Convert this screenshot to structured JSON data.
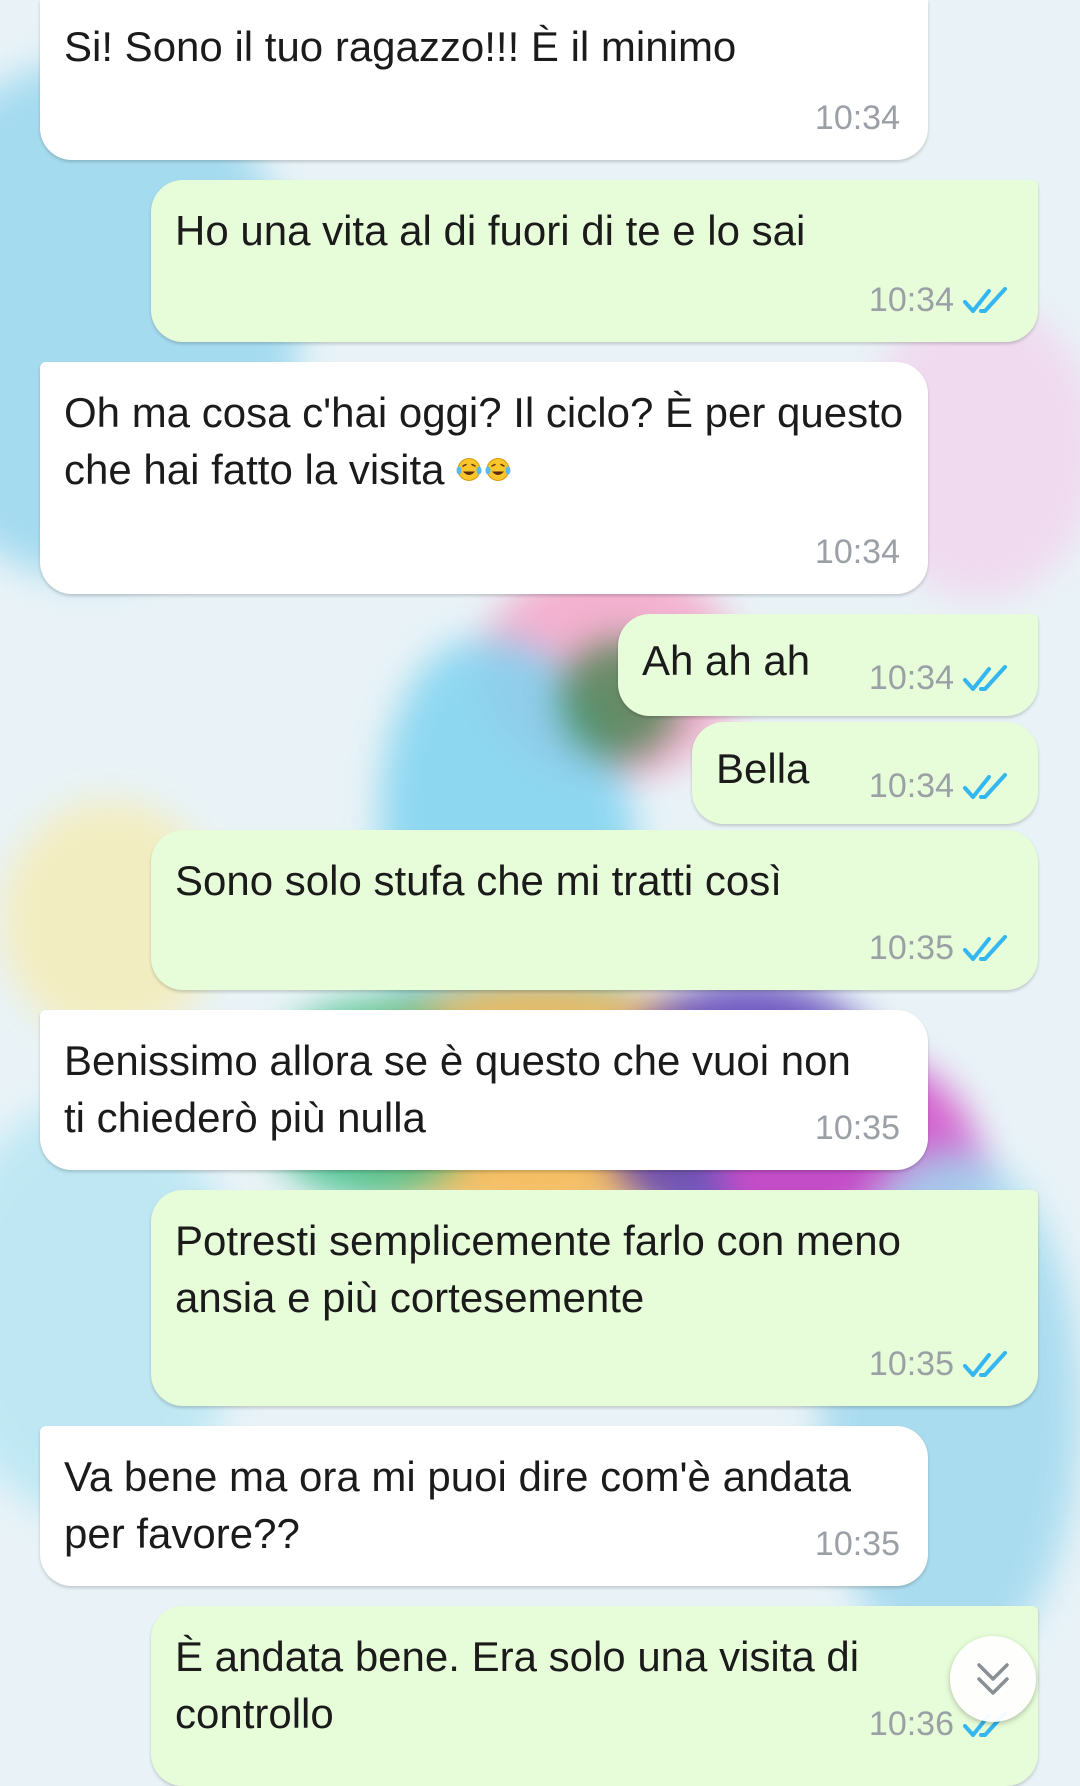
{
  "messages": [
    {
      "direction": "incoming",
      "text": "Si! Sono il tuo ragazzo!!! È il minimo",
      "time": "10:34"
    },
    {
      "direction": "outgoing",
      "text": "Ho una vita al di fuori di te e lo sai",
      "time": "10:34",
      "status": "read"
    },
    {
      "direction": "incoming",
      "text": "Oh ma cosa c'hai oggi? Il ciclo? È per questo che hai fatto la visita",
      "emoji": "tears-of-joy ×2",
      "time": "10:34"
    },
    {
      "direction": "outgoing",
      "text": "Ah ah ah",
      "time": "10:34",
      "status": "read"
    },
    {
      "direction": "outgoing",
      "text": "Bella",
      "time": "10:34",
      "status": "read"
    },
    {
      "direction": "outgoing",
      "text": "Sono solo stufa che mi tratti così",
      "time": "10:35",
      "status": "read"
    },
    {
      "direction": "incoming",
      "text": "Benissimo allora se è questo che vuoi non ti chiederò più nulla",
      "time": "10:35"
    },
    {
      "direction": "outgoing",
      "text": "Potresti semplicemente farlo con meno ansia e più cortesemente",
      "time": "10:35",
      "status": "read"
    },
    {
      "direction": "incoming",
      "text": "Va bene ma ora mi puoi dire com'è andata per favore??",
      "time": "10:35"
    },
    {
      "direction": "outgoing",
      "text": "È andata bene. Era solo una visita di controllo",
      "time": "10:36",
      "status": "read"
    }
  ],
  "icons": {
    "read_receipt": "double-check-icon",
    "scroll": "chevron-double-down-icon",
    "emoji": "face-with-tears-of-joy-icon"
  },
  "colors": {
    "incoming_bubble": "#ffffff",
    "outgoing_bubble": "#e7fdd9",
    "tick_blue": "#34b7f1",
    "time_gray": "#9aa0a6"
  }
}
